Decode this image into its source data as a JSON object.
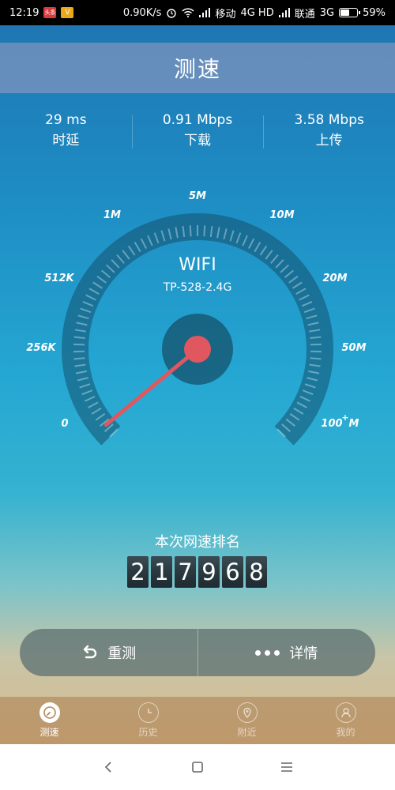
{
  "status_bar": {
    "time": "12:19",
    "badge1": "头条",
    "badge2": "V",
    "speed": "0.90K/s",
    "carrier1": "移动",
    "network1": "4G HD",
    "carrier2": "联通",
    "network2": "3G",
    "battery": "59%",
    "battery_level": 0.59
  },
  "header": {
    "title": "测速"
  },
  "stats": [
    {
      "value": "29 ms",
      "label": "时延"
    },
    {
      "value": "0.91 Mbps",
      "label": "下载"
    },
    {
      "value": "3.58 Mbps",
      "label": "上传"
    }
  ],
  "gauge": {
    "ticks": [
      "0",
      "256K",
      "512K",
      "1M",
      "5M",
      "10M",
      "20M",
      "50M",
      "100",
      "M"
    ],
    "network_type": "WIFI",
    "ssid": "TP-528-2.4G",
    "needle_position": 0.02
  },
  "rank": {
    "title": "本次网速排名",
    "digits": [
      "2",
      "1",
      "7",
      "9",
      "6",
      "8"
    ]
  },
  "actions": {
    "retest": "重测",
    "details": "详情"
  },
  "tabs": [
    {
      "label": "测速",
      "icon": "speedometer-icon",
      "active": true
    },
    {
      "label": "历史",
      "icon": "clock-icon",
      "active": false
    },
    {
      "label": "附近",
      "icon": "location-pin-icon",
      "active": false
    },
    {
      "label": "我的",
      "icon": "user-icon",
      "active": false
    }
  ],
  "colors": {
    "needle": "#e0575f",
    "hub": "#1e5f7a",
    "title_bar": "#7d94be",
    "active_tab_icon": "#ffffff"
  }
}
